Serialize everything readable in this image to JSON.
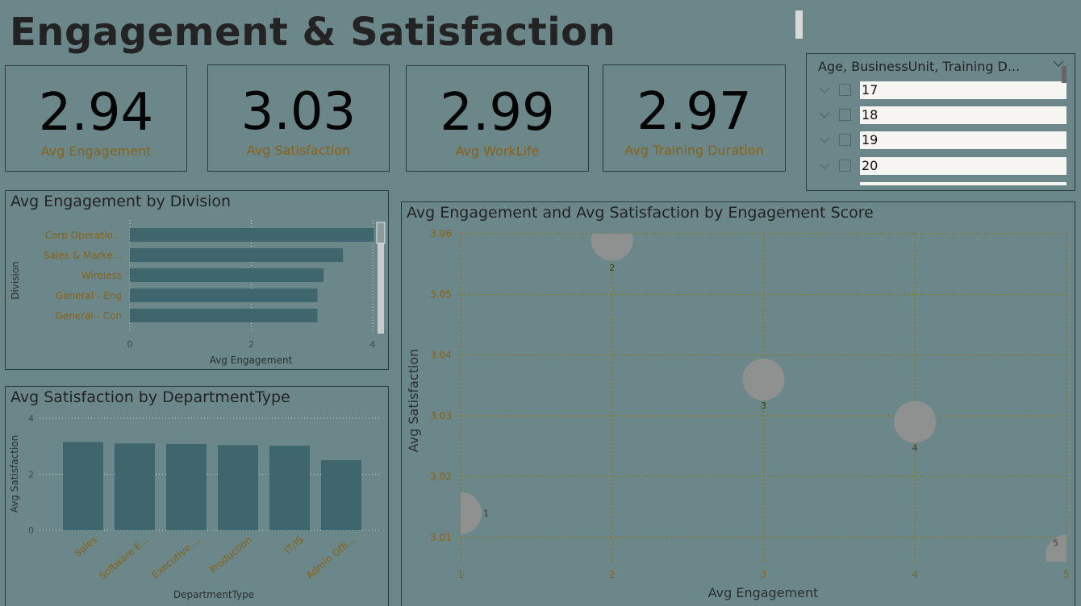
{
  "page": {
    "title": "Engagement & Satisfaction"
  },
  "kpis": [
    {
      "value": "2.94",
      "label": "Avg Engagement"
    },
    {
      "value": "3.03",
      "label": "Avg Satisfaction"
    },
    {
      "value": "2.99",
      "label": "Avg WorkLife"
    },
    {
      "value": "2.97",
      "label": "Avg Training Duration"
    }
  ],
  "slicer": {
    "header": "Age, BusinessUnit, Training D...",
    "items": [
      "17",
      "18",
      "19",
      "20"
    ]
  },
  "colors": {
    "background": "#6b878a",
    "bar": "#3f666c",
    "bubble": "#8f9191",
    "accent_text": "#8a6214",
    "gridline": "#8a7a1c"
  },
  "chart_data": [
    {
      "type": "bar",
      "orientation": "horizontal",
      "title": "Avg Engagement by Division",
      "xlabel": "Avg Engagement",
      "ylabel": "Division",
      "categories": [
        "Corp Operatio...",
        "Sales & Marke...",
        "Wireless",
        "General - Eng",
        "General - Con"
      ],
      "values": [
        4.02,
        3.51,
        3.19,
        3.09,
        3.09
      ],
      "xlim": [
        0,
        4
      ],
      "xticks": [
        "0",
        "2",
        "4"
      ],
      "grid": true
    },
    {
      "type": "bar",
      "title": "Avg Satisfaction by DepartmentType",
      "xlabel": "DepartmentType",
      "ylabel": "Avg Satisfaction",
      "categories": [
        "Sales",
        "Software E...",
        "Executive ...",
        "Production",
        "IT/IS",
        "Admin Offi..."
      ],
      "values": [
        3.15,
        3.1,
        3.08,
        3.04,
        3.02,
        2.5
      ],
      "ylim": [
        0,
        4
      ],
      "yticks": [
        "0",
        "2",
        "4"
      ],
      "grid": true
    },
    {
      "type": "scatter",
      "title": "Avg Engagement and Avg Satisfaction by Engagement Score",
      "xlabel": "Avg Engagement",
      "ylabel": "Avg Satisfaction",
      "points": [
        {
          "x": 1,
          "y": 3.014,
          "label": "1"
        },
        {
          "x": 2,
          "y": 3.059,
          "label": "2"
        },
        {
          "x": 3,
          "y": 3.036,
          "label": "3"
        },
        {
          "x": 4,
          "y": 3.029,
          "label": "4"
        },
        {
          "x": 5,
          "y": 3.007,
          "label": "5"
        }
      ],
      "xlim": [
        1,
        5
      ],
      "ylim": [
        3.006,
        3.06
      ],
      "xticks": [
        "1",
        "2",
        "3",
        "4",
        "5"
      ],
      "yticks": [
        "3.01",
        "3.02",
        "3.03",
        "3.04",
        "3.05",
        "3.06"
      ],
      "grid": true
    }
  ]
}
